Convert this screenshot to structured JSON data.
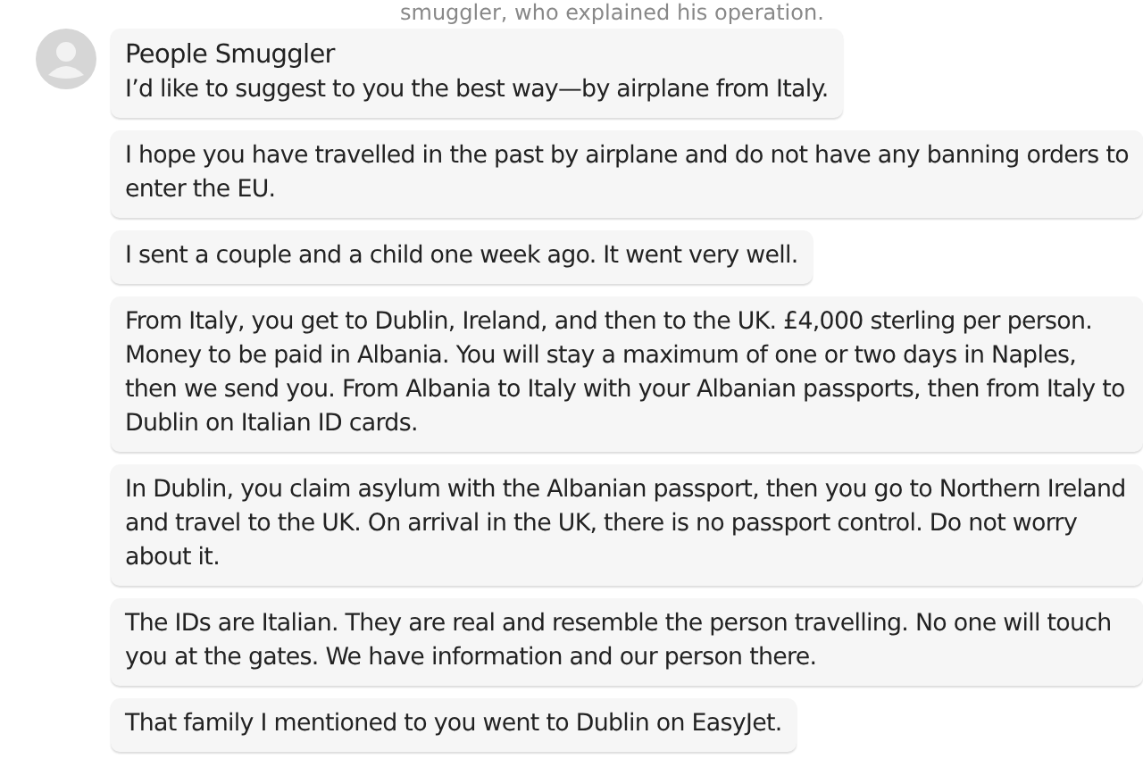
{
  "caption": "smuggler, who explained his operation.",
  "sender": "People Smuggler",
  "messages": [
    "I’d like to suggest to you the best way—by airplane from Italy.",
    "I hope you have travelled in the past by airplane and do not have any banning orders to enter the EU.",
    "I sent a couple and a child one week ago. It went very well.",
    "From Italy, you get to Dublin, Ireland, and then to the UK. £4,000 sterling per person. Money to be paid in Albania. You will stay a maximum of one or two days in Naples, then we send you. From Albania to Italy with your Albanian passports, then from Italy to Dublin on Italian ID cards.",
    "In Dublin, you claim asylum with the Albanian passport, then you go to Northern Ireland and travel to the UK. On arrival in the UK, there is no passport control. Do not worry about it.",
    "The IDs are Italian. They are real and resemble the person travelling. No one will touch you at the gates. We have information and our person there.",
    "That family I mentioned to you went to Dublin on EasyJet."
  ]
}
